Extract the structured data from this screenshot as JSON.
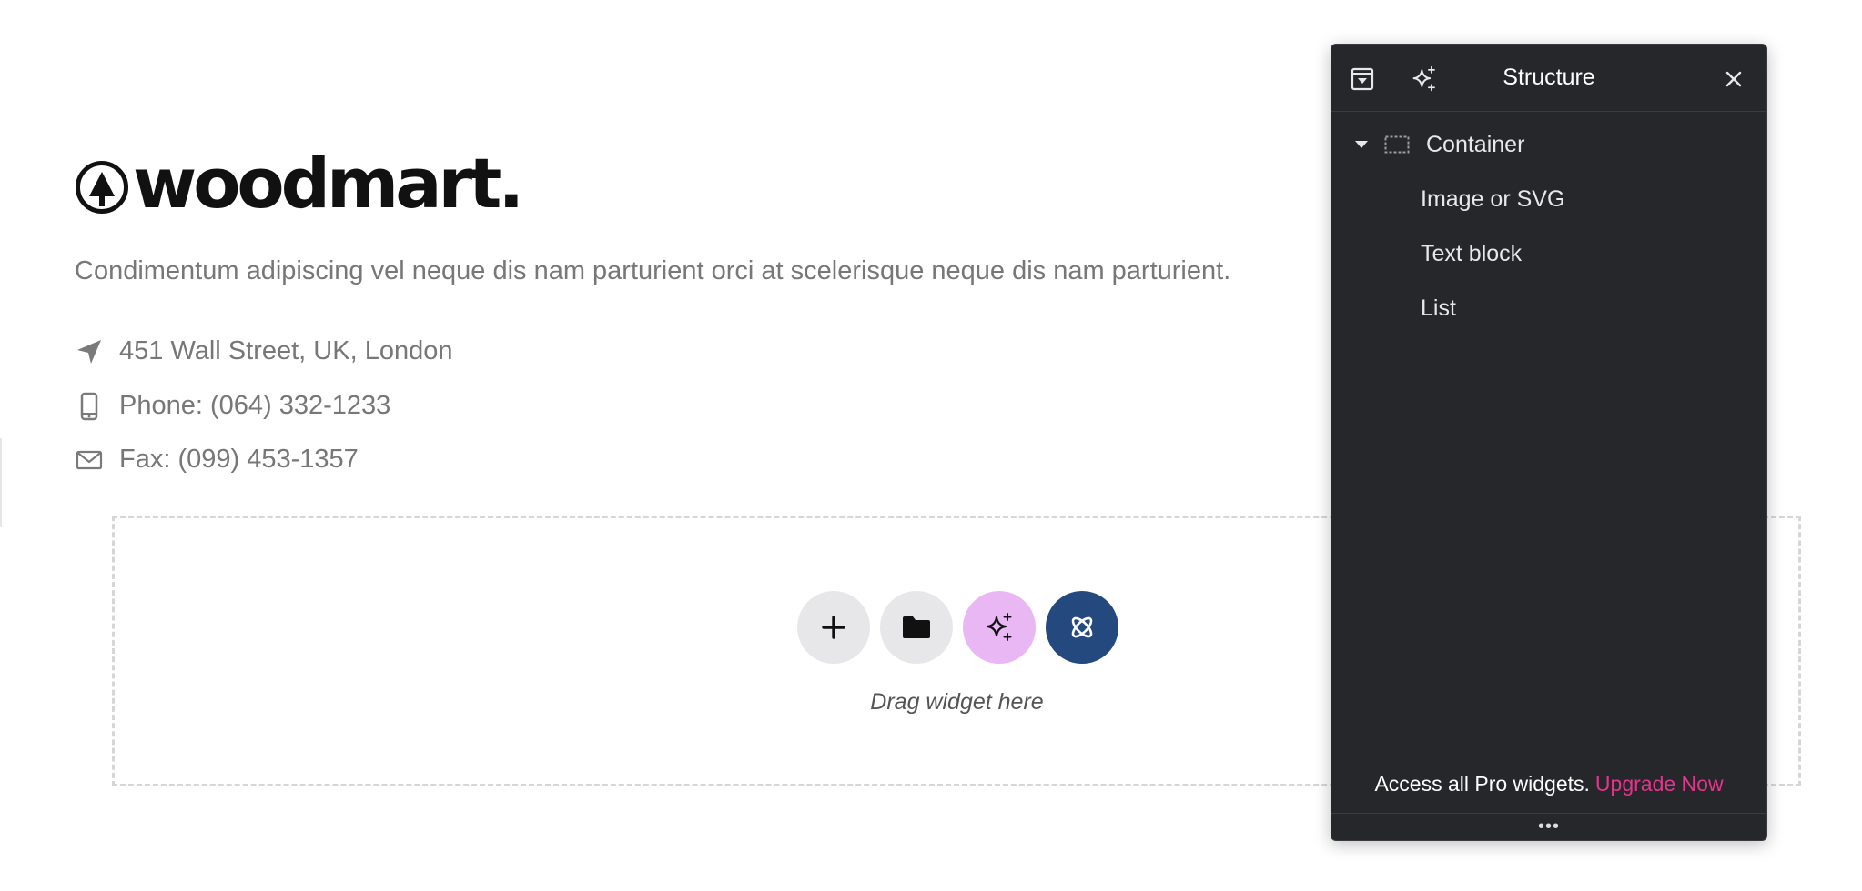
{
  "brand": {
    "logo_text": "woodmart."
  },
  "content": {
    "description": "Condimentum adipiscing vel neque dis nam parturient orci at scelerisque neque dis nam parturient.",
    "contacts": [
      {
        "icon": "location-arrow-icon",
        "text": "451 Wall Street, UK, London"
      },
      {
        "icon": "phone-icon",
        "text": "Phone: (064) 332-1233"
      },
      {
        "icon": "envelope-icon",
        "text": "Fax: (099) 453-1357"
      }
    ]
  },
  "dropzone": {
    "buttons": [
      {
        "name": "add-section-button",
        "icon": "plus-icon"
      },
      {
        "name": "template-library-button",
        "icon": "folder-icon"
      },
      {
        "name": "ai-generate-button",
        "icon": "sparkles-icon"
      },
      {
        "name": "site-kit-button",
        "icon": "atom-icon"
      }
    ],
    "label": "Drag widget here"
  },
  "panel": {
    "title": "Structure",
    "tree": {
      "root": "Container",
      "children": [
        "Image or SVG",
        "Text block",
        "List"
      ]
    },
    "footer": {
      "text": "Access all Pro widgets.",
      "link": "Upgrade Now"
    },
    "handle": "•••"
  },
  "colors": {
    "panel_bg": "#26272b",
    "upgrade_link": "#e3358c",
    "ai_button": "#e9b8f4",
    "site_button": "#24497e",
    "body_text": "#777777"
  }
}
